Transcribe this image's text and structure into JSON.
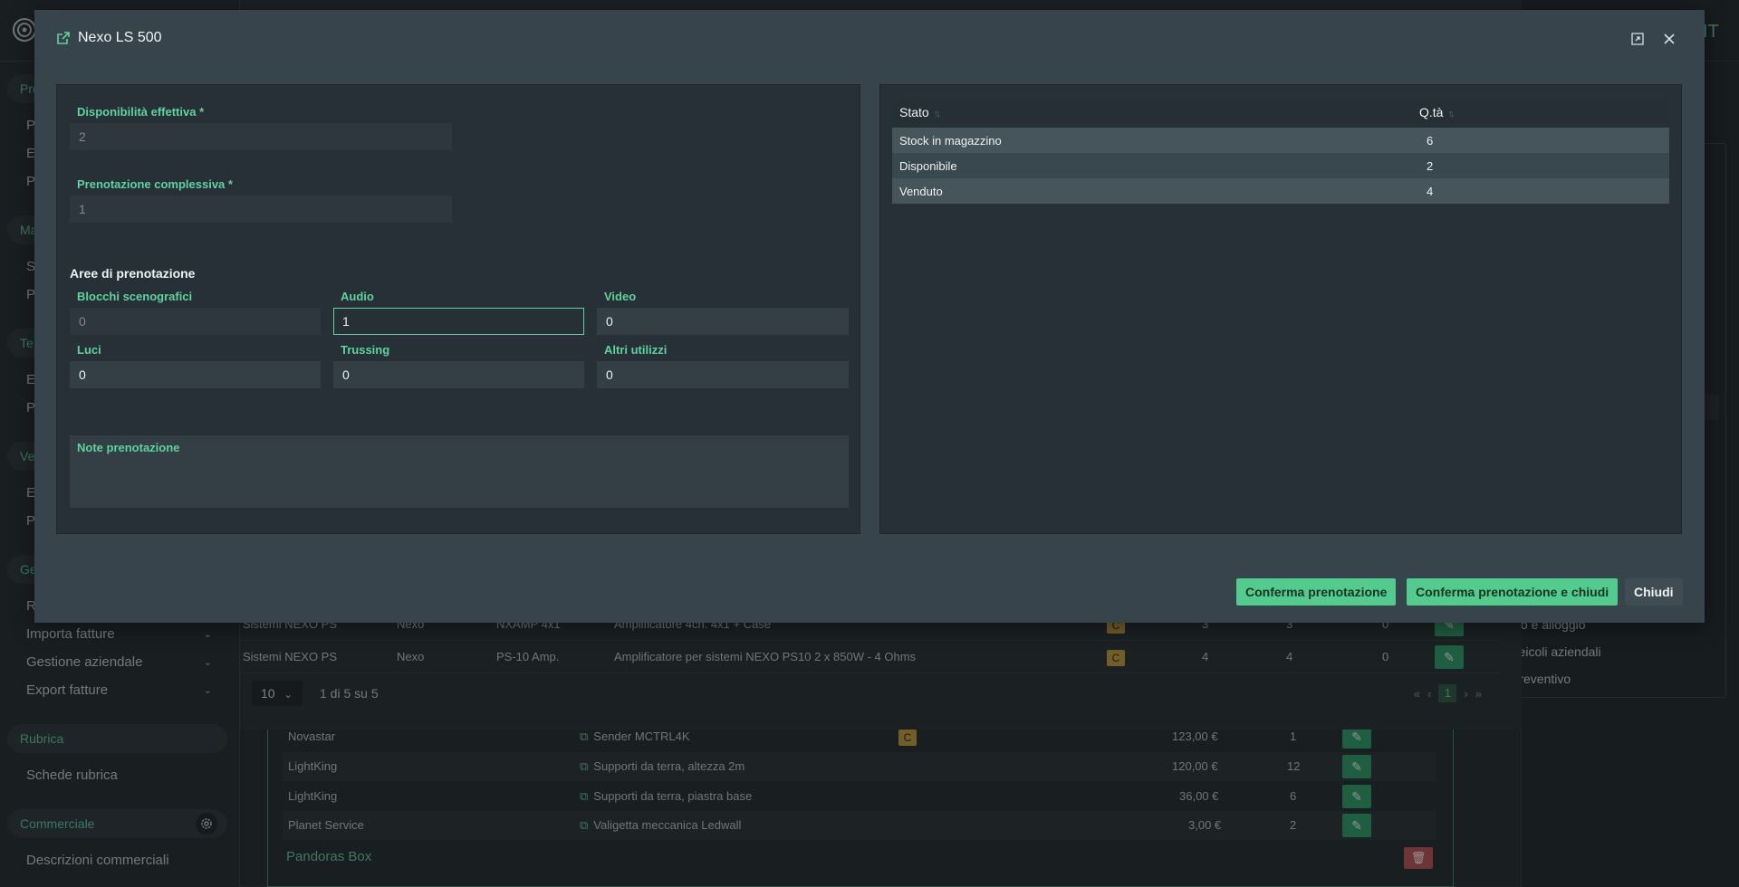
{
  "sidebar": {
    "sections": [
      {
        "label": "Pro",
        "items": [
          "P",
          "E",
          "P"
        ]
      },
      {
        "label": "Ma",
        "items": [
          "S",
          "P"
        ]
      },
      {
        "label": "Te",
        "items": [
          "E",
          "P"
        ]
      },
      {
        "label": "Ve",
        "items": [
          "E",
          "P"
        ]
      },
      {
        "label": "Ge",
        "items": [
          "R",
          "Importa fatture",
          "Gestione aziendale",
          "Export fatture"
        ]
      },
      {
        "label": "Rubrica",
        "items": [
          "Schede rubrica"
        ]
      },
      {
        "label": "Commerciale",
        "items": [
          "Descrizioni commerciali"
        ]
      }
    ]
  },
  "header": {
    "avatar_text": "IT"
  },
  "right_panel": {
    "links": [
      "itto e alloggio",
      "Veicoli aziendali",
      "Preventivo"
    ]
  },
  "background_table": {
    "rows": [
      {
        "group": "Sistemi NEXO PS",
        "brand": "Nexo",
        "code": "NXAMP 4x1",
        "desc": "Amplificatore 4ch. 4x1 + Case",
        "badge": "C",
        "q1": "3",
        "q2": "3",
        "q3": "0"
      },
      {
        "group": "Sistemi NEXO PS",
        "brand": "Nexo",
        "code": "PS-10 Amp.",
        "desc": "Amplificatore per sistemi NEXO PS10 2 x 850W - 4 Ohms",
        "badge": "C",
        "q1": "4",
        "q2": "4",
        "q3": "0"
      }
    ],
    "page_size": "10",
    "page_info": "1 di 5 su 5",
    "current_page": "1"
  },
  "lower_table": {
    "rows": [
      {
        "brand": "Novastar",
        "desc": "Sender MCTRL4K",
        "badge": "C",
        "price": "123,00 €",
        "qty": "1"
      },
      {
        "brand": "LightKing",
        "desc": "Supporti da terra, altezza 2m",
        "badge": "",
        "price": "120,00 €",
        "qty": "12"
      },
      {
        "brand": "LightKing",
        "desc": "Supporti da terra, piastra base",
        "badge": "",
        "price": "36,00 €",
        "qty": "6"
      },
      {
        "brand": "Planet Service",
        "desc": "Valigetta meccanica Ledwall",
        "badge": "",
        "price": "3,00 €",
        "qty": "2"
      }
    ],
    "group_title": "Pandoras Box"
  },
  "modal": {
    "title": "Nexo LS 500",
    "fields": {
      "disponibilita_label": "Disponibilità effettiva *",
      "disponibilita_value": "2",
      "prenotazione_label": "Prenotazione complessiva *",
      "prenotazione_value": "1",
      "aree_label": "Aree di prenotazione",
      "blocchi_label": "Blocchi scenografici",
      "blocchi_value": "0",
      "audio_label": "Audio",
      "audio_value": "1",
      "video_label": "Video",
      "video_value": "0",
      "luci_label": "Luci",
      "luci_value": "0",
      "trussing_label": "Trussing",
      "trussing_value": "0",
      "altri_label": "Altri utilizzi",
      "altri_value": "0",
      "note_label": "Note prenotazione"
    },
    "stock_table": {
      "headers": [
        "Stato",
        "Q.tà"
      ],
      "rows": [
        {
          "stato": "Stock in magazzino",
          "qta": "6"
        },
        {
          "stato": "Disponibile",
          "qta": "2"
        },
        {
          "stato": "Venduto",
          "qta": "4"
        }
      ]
    },
    "buttons": {
      "confirm": "Conferma prenotazione",
      "confirm_close": "Conferma prenotazione e chiudi",
      "close": "Chiudi"
    }
  },
  "colors": {
    "accent": "#5dd49a",
    "badge": "#caa03c",
    "danger": "#c25454",
    "modal_bg": "#37444b"
  }
}
